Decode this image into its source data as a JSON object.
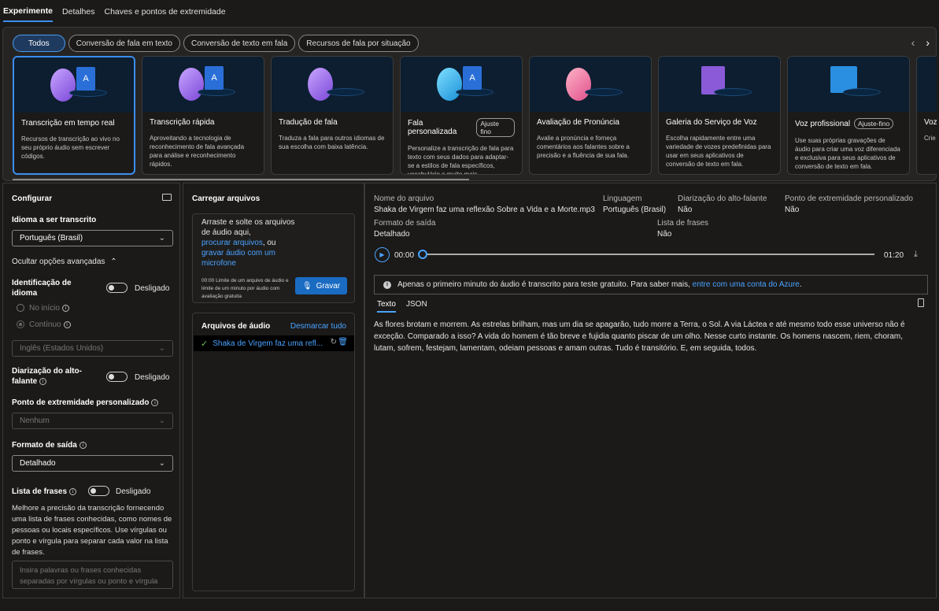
{
  "tabs": [
    "Experimente",
    "Detalhes",
    "Chaves e pontos de extremidade"
  ],
  "filters": [
    "Todos",
    "Conversão de fala em texto",
    "Conversão de texto em fala",
    "Recursos de fala por situação"
  ],
  "nav": {
    "prev": "‹",
    "next": "›"
  },
  "cards": [
    {
      "title": "Transcrição em tempo real",
      "badge": "",
      "desc": "Recursos de transcrição ao vivo no seu próprio áudio sem escrever códigos."
    },
    {
      "title": "Transcrição rápida",
      "badge": "",
      "desc": "Aproveitando a tecnologia de reconhecimento de fala avançada para análise e reconhecimento rápidos."
    },
    {
      "title": "Tradução de fala",
      "badge": "",
      "desc": "Traduza a fala para outros idiomas de sua escolha com baixa latência."
    },
    {
      "title": "Fala personalizada",
      "badge": "Ajuste fino",
      "desc": "Personalize a transcrição de fala para texto com seus dados para adaptar-se a estilos de fala específicos, vocabulário e muito mais."
    },
    {
      "title": "Avaliação de Pronúncia",
      "badge": "",
      "desc": "Avalie a pronúncia e forneça comentários aos falantes sobre a precisão e a fluência de sua fala."
    },
    {
      "title": "Galeria do Serviço de Voz",
      "badge": "",
      "desc": "Escolha rapidamente entre uma variedade de vozes predefinidas para usar em seus aplicativos de conversão de texto em fala."
    },
    {
      "title": "Voz profissional",
      "badge": "Ajuste-fino",
      "desc": "Use suas próprias gravações de áudio para criar uma voz diferenciada e exclusiva para seus aplicativos de conversão de texto em fala."
    },
    {
      "title": "Voz",
      "badge": "",
      "desc": "Crie a par hum"
    }
  ],
  "config": {
    "title": "Configurar",
    "lang_label": "Idioma a ser transcrito",
    "lang_value": "Português (Brasil)",
    "advanced": "Ocultar opções avançadas",
    "langid_label": "Identificação de idioma",
    "langid_state": "Desligado",
    "opt_start": "No início",
    "opt_cont": "Contínuo",
    "langid_select": "Inglês (Estados Unidos)",
    "diar_label": "Diarização do alto-falante",
    "diar_state": "Desligado",
    "endpoint_label": "Ponto de extremidade personalizado",
    "endpoint_value": "Nenhum",
    "format_label": "Formato de saída",
    "format_value": "Detalhado",
    "phrase_label": "Lista de frases",
    "phrase_state": "Desligado",
    "phrase_help": "Melhore a precisão da transcrição fornecendo uma lista de frases conhecidas, como nomes de pessoas ou locais específicos. Use vírgulas ou ponto e vírgula para separar cada valor na lista de frases.",
    "phrase_placeholder": "Insira palavras ou frases conhecidas separadas por vírgulas ou ponto e vírgula"
  },
  "upload": {
    "title": "Carregar arquivos",
    "drop1": "Arraste e solte os arquivos de áudio aqui,",
    "browse": "procurar arquivos",
    "or": ", ou",
    "record_link": "gravar áudio com um microfone",
    "limit": "00:00 Limite de um arquivo de áudio e limite de um minuto por áudio com avaliação gratuita",
    "record_btn": "Gravar",
    "files_title": "Arquivos de áudio",
    "deselect": "Desmarcar tudo",
    "file_name": "Shaka de Virgem faz uma refl..."
  },
  "result": {
    "h_file": "Nome do arquivo",
    "v_file": "Shaka de Virgem faz uma reflexão Sobre a Vida e a Morte.mp3",
    "h_lang": "Linguagem",
    "v_lang": "Português (Brasil)",
    "h_diar": "Diarização do alto-falante",
    "v_diar": "Não",
    "h_endp": "Ponto de extremidade personalizado",
    "v_endp": "Não",
    "h_fmt": "Formato de saída",
    "v_fmt": "Detalhado",
    "h_phr": "Lista de frases",
    "v_phr": "Não",
    "t_start": "00:00",
    "t_end": "01:20",
    "notice": "Apenas o primeiro minuto do áudio é transcrito para teste gratuito. Para saber mais,",
    "notice_link": "entre com uma conta do Azure",
    "tab_text": "Texto",
    "tab_json": "JSON",
    "transcript": "As flores brotam e morrem. As estrelas brilham, mas um dia se apagarão, tudo morre a Terra, o Sol. A via Láctea e até mesmo todo esse universo não é exceção. Comparado a isso? A vida do homem é tão breve e fujidia quanto piscar de um olho. Nesse curto instante. Os homens nascem, riem, choram, lutam, sofrem, festejam, lamentam, odeiam pessoas e amam outras. Tudo é transitório. E, em seguida, todos."
  }
}
